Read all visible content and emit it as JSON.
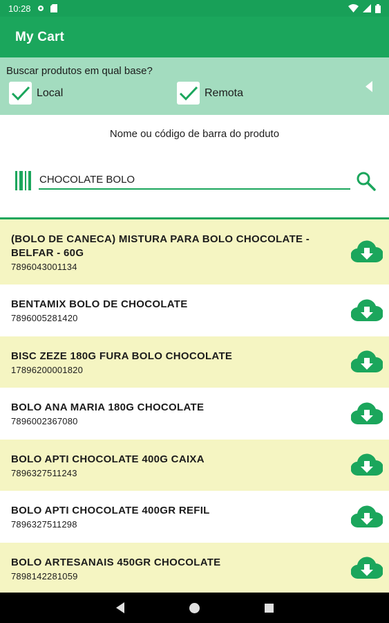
{
  "status_bar": {
    "time": "10:28"
  },
  "app_bar": {
    "title": "My Cart"
  },
  "filter": {
    "question": "Buscar produtos em qual base?",
    "local_label": "Local",
    "remote_label": "Remota"
  },
  "search": {
    "hint": "Nome ou código de barra do produto",
    "query": "CHOCOLATE BOLO"
  },
  "products": [
    {
      "name": "(BOLO DE CANECA) MISTURA PARA BOLO CHOCOLATE - BELFAR - 60G",
      "code": "7896043001134"
    },
    {
      "name": "BENTAMIX BOLO DE CHOCOLATE",
      "code": "7896005281420"
    },
    {
      "name": "BISC ZEZE 180G FURA BOLO CHOCOLATE",
      "code": "17896200001820"
    },
    {
      "name": "BOLO ANA MARIA 180G CHOCOLATE",
      "code": "7896002367080"
    },
    {
      "name": "BOLO APTI CHOCOLATE 400G CAIXA",
      "code": "7896327511243"
    },
    {
      "name": "BOLO APTI CHOCOLATE 400GR REFIL",
      "code": "7896327511298"
    },
    {
      "name": "BOLO ARTESANAIS 450GR CHOCOLATE",
      "code": "7898142281059"
    }
  ],
  "colors": {
    "primary": "#1ba65c",
    "filter_bg": "#a3dcbf",
    "row_alt": "#f5f5c2"
  }
}
